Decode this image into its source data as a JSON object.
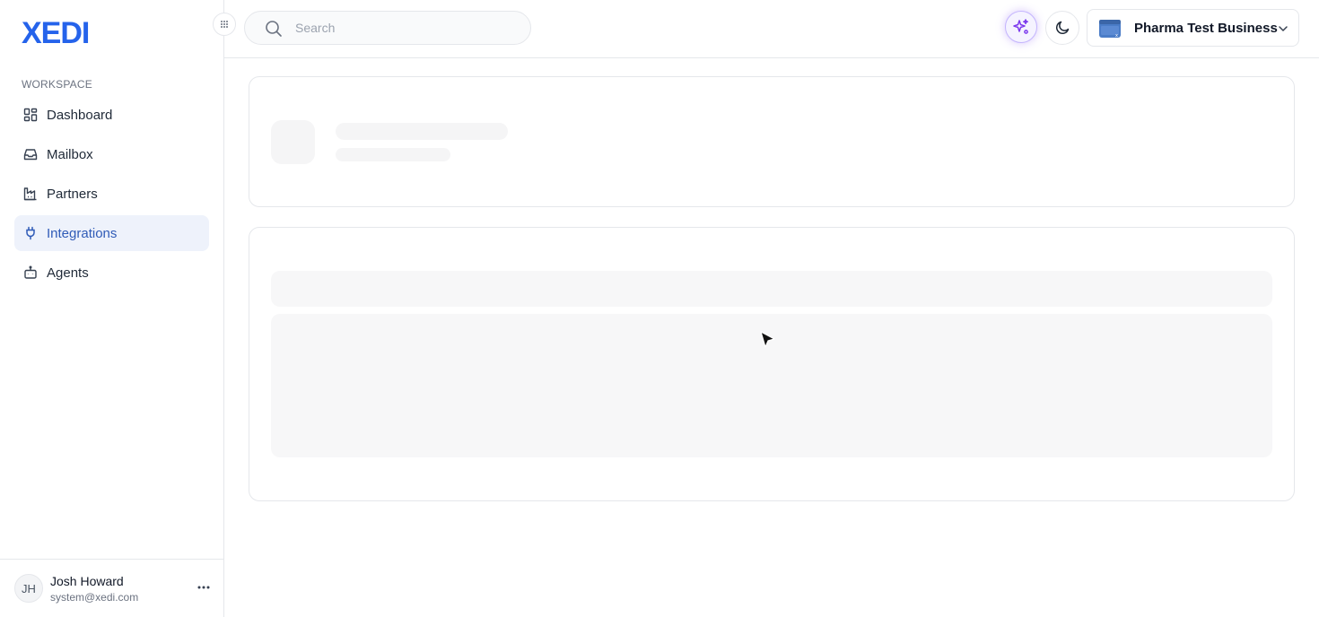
{
  "brand": {
    "logo_text": "XEDI",
    "accent": "#2563eb"
  },
  "sidebar": {
    "section_label": "WORKSPACE",
    "items": [
      {
        "label": "Dashboard",
        "icon": "dashboard-grid-icon",
        "active": false
      },
      {
        "label": "Mailbox",
        "icon": "inbox-icon",
        "active": false
      },
      {
        "label": "Partners",
        "icon": "factory-icon",
        "active": false
      },
      {
        "label": "Integrations",
        "icon": "plug-icon",
        "active": true
      },
      {
        "label": "Agents",
        "icon": "bot-icon",
        "active": false
      }
    ],
    "user": {
      "initials": "JH",
      "name": "Josh Howard",
      "email": "system@xedi.com"
    }
  },
  "topbar": {
    "search": {
      "placeholder": "Search",
      "value": ""
    },
    "ai_button_icon": "sparkles-icon",
    "theme_button_icon": "moon-icon",
    "business": {
      "name": "Pharma Test Business"
    }
  },
  "colors": {
    "active_nav_bg": "#eef2fb",
    "active_nav_text": "#2f5bb7",
    "ai_accent": "#7c3aed",
    "skeleton": "#f5f5f6"
  }
}
